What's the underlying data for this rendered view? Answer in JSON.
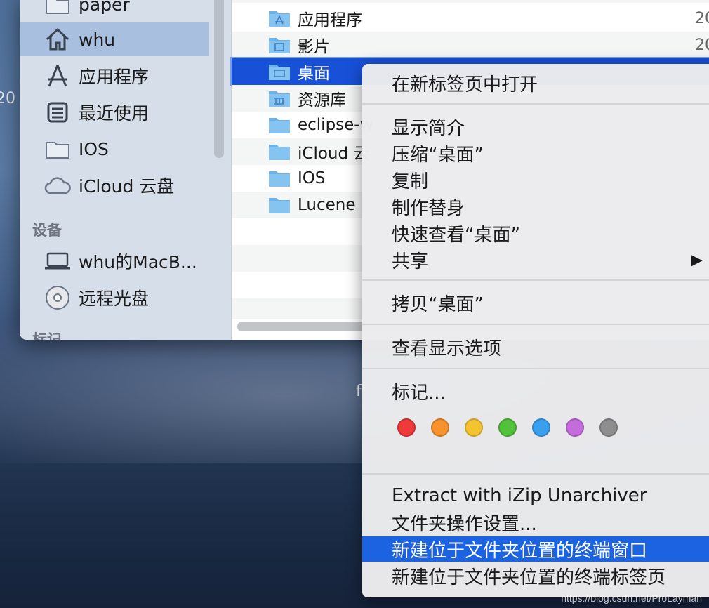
{
  "sidebar": {
    "items": [
      {
        "label": "paper",
        "icon": "folder-icon"
      },
      {
        "label": "whu",
        "icon": "home-icon"
      },
      {
        "label": "应用程序",
        "icon": "applications-icon"
      },
      {
        "label": "最近使用",
        "icon": "recents-icon"
      },
      {
        "label": "IOS",
        "icon": "folder-icon"
      },
      {
        "label": "iCloud 云盘",
        "icon": "cloud-icon"
      }
    ],
    "devices_header": "设备",
    "devices": [
      {
        "label": "whu的MacB...",
        "icon": "laptop-icon"
      },
      {
        "label": "远程光盘",
        "icon": "disc-icon"
      }
    ],
    "tags_header": "标记"
  },
  "files": {
    "rows": [
      {
        "name": "应用程序",
        "date": "20"
      },
      {
        "name": "影片",
        "date": "20"
      },
      {
        "name": "桌面",
        "date": ""
      },
      {
        "name": "资源库",
        "date": ""
      },
      {
        "name": "eclipse-w",
        "date": ""
      },
      {
        "name": "iCloud 云",
        "date": ""
      },
      {
        "name": "IOS",
        "date": ""
      },
      {
        "name": "Lucene",
        "date": ""
      }
    ]
  },
  "menu": {
    "open_new_tab": "在新标签页中打开",
    "get_info": "显示简介",
    "compress": "压缩“桌面”",
    "duplicate": "复制",
    "make_alias": "制作替身",
    "quick_look": "快速查看“桌面”",
    "share": "共享",
    "copy": "拷贝“桌面”",
    "view_options": "查看显示选项",
    "tags": "标记...",
    "extract": "Extract with iZip Unarchiver",
    "folder_actions": "文件夹操作设置...",
    "new_terminal": "新建位于文件夹位置的终端窗口",
    "new_terminal_tab": "新建位于文件夹位置的终端标签页"
  },
  "tag_colors": [
    "#f0393a",
    "#f7922d",
    "#f4c430",
    "#52c23a",
    "#3b9ff0",
    "#c46cdb",
    "#8e8e8e"
  ],
  "desktop": {
    "left_text": "20",
    "mid_text": "f"
  },
  "watermark": "https://blog.csdn.net/ProLayman"
}
